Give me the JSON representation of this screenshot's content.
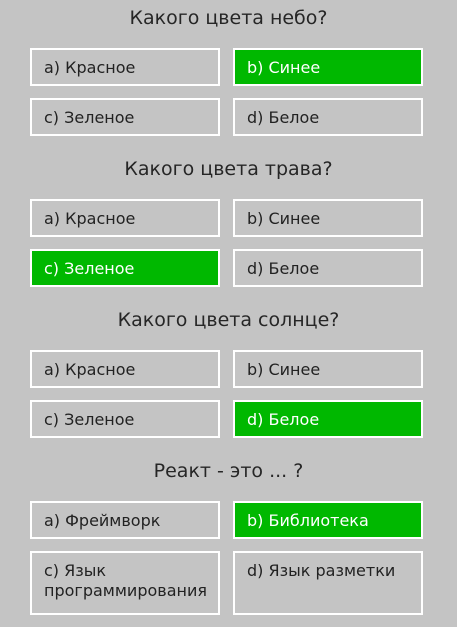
{
  "questions": [
    {
      "title": "Какого цвета небо?",
      "answers": [
        {
          "label": "a) Красное",
          "correct": false
        },
        {
          "label": "b) Синее",
          "correct": true
        },
        {
          "label": "c) Зеленое",
          "correct": false
        },
        {
          "label": "d) Белое",
          "correct": false
        }
      ]
    },
    {
      "title": "Какого цвета трава?",
      "answers": [
        {
          "label": "a) Красное",
          "correct": false
        },
        {
          "label": "b) Синее",
          "correct": false
        },
        {
          "label": "c) Зеленое",
          "correct": true
        },
        {
          "label": "d) Белое",
          "correct": false
        }
      ]
    },
    {
      "title": "Какого цвета солнце?",
      "answers": [
        {
          "label": "a) Красное",
          "correct": false
        },
        {
          "label": "b) Синее",
          "correct": false
        },
        {
          "label": "c) Зеленое",
          "correct": false
        },
        {
          "label": "d) Белое",
          "correct": true
        }
      ]
    },
    {
      "title": "Реакт - это ... ?",
      "answers": [
        {
          "label": "a) Фреймворк",
          "correct": false
        },
        {
          "label": "b) Библиотека",
          "correct": true
        },
        {
          "label": "c) Язык программирования",
          "correct": false
        },
        {
          "label": "d) Язык разметки",
          "correct": false
        }
      ]
    }
  ],
  "colors": {
    "background": "#c4c4c4",
    "correct": "#00b800",
    "border": "#ffffff"
  }
}
